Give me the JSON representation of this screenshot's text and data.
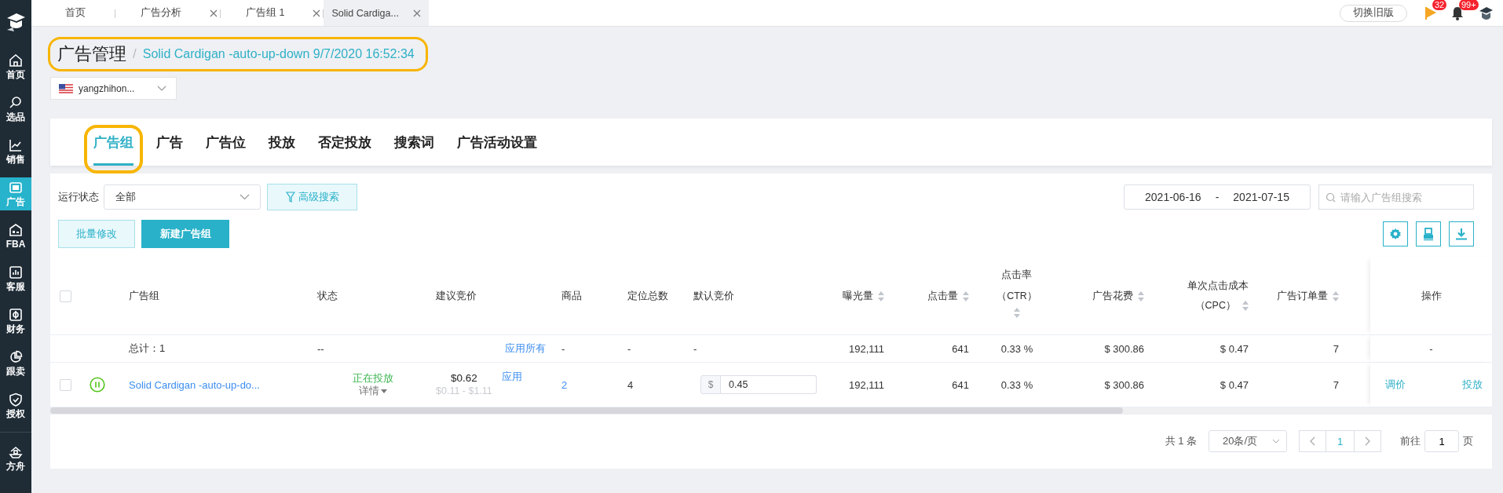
{
  "sidebar": {
    "items": [
      {
        "label": "首页",
        "selected": false
      },
      {
        "label": "选品",
        "selected": false
      },
      {
        "label": "销售",
        "selected": false
      },
      {
        "label": "广告",
        "selected": true
      },
      {
        "label": "FBA",
        "selected": false
      },
      {
        "label": "客服",
        "selected": false
      },
      {
        "label": "财务",
        "selected": false
      },
      {
        "label": "跟卖",
        "selected": false
      },
      {
        "label": "授权",
        "selected": false
      }
    ],
    "footer_item": {
      "label": "方舟"
    }
  },
  "top_tabs": [
    {
      "label": "首页",
      "closable": false,
      "selected": false
    },
    {
      "label": "广告分析",
      "closable": true,
      "selected": false
    },
    {
      "label": "广告组 1",
      "closable": true,
      "selected": false
    },
    {
      "label": "Solid Cardiga...",
      "closable": true,
      "selected": true
    }
  ],
  "top_bar": {
    "switch_button": "切换旧版",
    "flag_badge": "32",
    "bell_badge": "99+"
  },
  "page_header": {
    "title": "广告管理",
    "separator": "/",
    "breadcrumb": "Solid Cardigan -auto-up-down 9/7/2020 16:52:34",
    "highlighted": true
  },
  "account": {
    "value": "yangzhihon..."
  },
  "tabs": [
    {
      "label": "广告组",
      "selected": true,
      "highlighted": true
    },
    {
      "label": "广告",
      "selected": false,
      "highlighted": false
    },
    {
      "label": "广告位",
      "selected": false,
      "highlighted": false
    },
    {
      "label": "投放",
      "selected": false,
      "highlighted": false
    },
    {
      "label": "否定投放",
      "selected": false,
      "highlighted": false
    },
    {
      "label": "搜索词",
      "selected": false,
      "highlighted": false
    },
    {
      "label": "广告活动设置",
      "selected": false,
      "highlighted": false
    }
  ],
  "filters": {
    "status_label": "运行状态",
    "status_value": "全部",
    "advanced_search": "高级搜索",
    "date_from": "2021-06-16",
    "date_separator": "-",
    "date_to": "2021-07-15",
    "search_placeholder": "请输入广告组搜索"
  },
  "actions": {
    "batch_edit": "批量修改",
    "new_group": "新建广告组"
  },
  "table": {
    "header_checked": false,
    "columns": [
      {
        "label": "广告组",
        "sortable": false
      },
      {
        "label": "状态",
        "sortable": false
      },
      {
        "label": "建议竞价",
        "sortable": false
      },
      {
        "label": "商品",
        "sortable": false
      },
      {
        "label": "定位总数",
        "sortable": false
      },
      {
        "label": "默认竞价",
        "sortable": false
      },
      {
        "label": "曝光量",
        "sortable": true
      },
      {
        "label": "点击量",
        "sortable": true
      },
      {
        "label": "点击率",
        "sublabel": "（CTR）",
        "sortable": true
      },
      {
        "label": "广告花费",
        "sortable": true
      },
      {
        "label": "单次点击成本",
        "sublabel": "（CPC）",
        "sortable": true
      },
      {
        "label": "广告订单量",
        "sortable": true
      },
      {
        "label": "操作",
        "sortable": false
      }
    ],
    "total_row": {
      "label": "总计：1",
      "status": "--",
      "bid_action": "应用所有",
      "products": "-",
      "targets": "-",
      "default_bid": "-",
      "impressions": "192,111",
      "clicks": "641",
      "ctr": "0.33 %",
      "spend": "$ 300.86",
      "cpc": "$ 0.47",
      "orders": "7",
      "operation": "-"
    },
    "rows": [
      {
        "checked": false,
        "running": true,
        "name": "Solid Cardigan -auto-up-do...",
        "status": "正在投放",
        "status_detail": "详情",
        "suggested_bid": "$0.62",
        "bid_range": "$0.11 - $1.11",
        "bid_action": "应用",
        "products": "2",
        "targets": "4",
        "currency": "$",
        "default_bid": "0.45",
        "impressions": "192,111",
        "clicks": "641",
        "ctr": "0.33 %",
        "spend": "$ 300.86",
        "cpc": "$ 0.47",
        "orders": "7",
        "actions": [
          "调价",
          "投放"
        ]
      }
    ]
  },
  "pagination": {
    "total": "共 1 条",
    "page_size": "20条/页",
    "pages": [
      {
        "label": "1",
        "selected": true
      }
    ],
    "goto_label": "前往",
    "goto_value": "1",
    "page_suffix": "页"
  }
}
